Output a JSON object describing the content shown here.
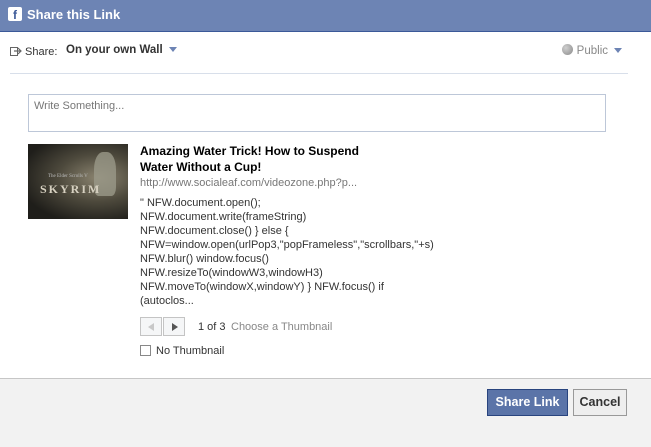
{
  "dialog": {
    "title": "Share this Link",
    "logo_letter": "f"
  },
  "share": {
    "label": "Share:",
    "target": "On your own Wall",
    "privacy": "Public"
  },
  "composer": {
    "placeholder": "Write Something..."
  },
  "link": {
    "title_line1": "Amazing Water Trick! How to Suspend",
    "title_line2": "Water Without a Cup!",
    "url": "http://www.socialeaf.com/videozone.php?p...",
    "description": "\" NFW.document.open();\nNFW.document.write(frameString)\nNFW.document.close() } else {\nNFW=window.open(urlPop3,\"popFrameless\",\"scrollbars,\"+s)\nNFW.blur() window.focus()\nNFW.resizeTo(windowW3,windowH3)\nNFW.moveTo(windowX,windowY) } NFW.focus() if\n(autoclos...",
    "thumbnail_text": "SKYRIM",
    "thumbnail_pretext": "The Elder Scrolls V"
  },
  "pager": {
    "count": "1 of 3",
    "choose": "Choose a Thumbnail"
  },
  "no_thumbnail": {
    "label": "No Thumbnail",
    "checked": false
  },
  "buttons": {
    "share": "Share Link",
    "cancel": "Cancel"
  },
  "colors": {
    "titlebar": "#6d84b4",
    "primary_button": "#5b74a8"
  }
}
